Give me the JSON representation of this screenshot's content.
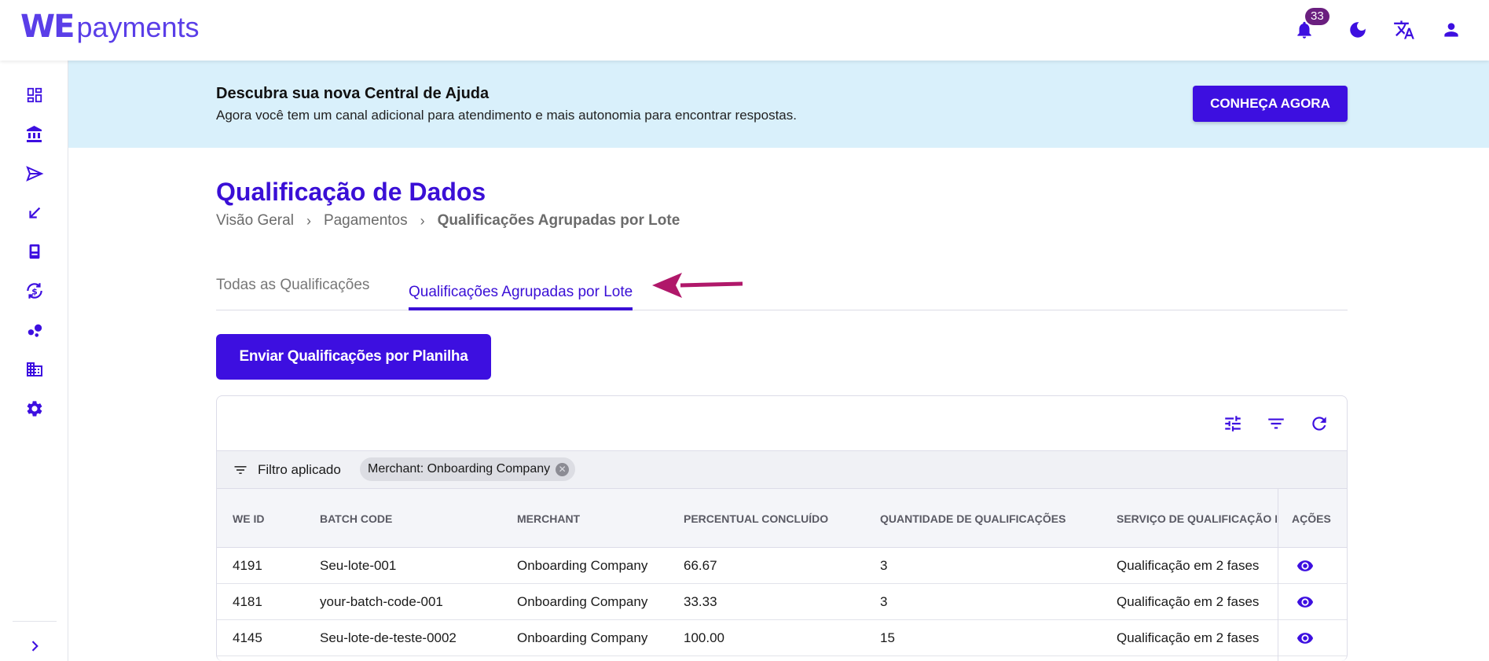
{
  "header": {
    "logo_we": "WE",
    "logo_payments": "payments",
    "notifications_count": "33",
    "icons": [
      "bell-icon",
      "moon-icon",
      "translate-icon",
      "user-icon"
    ]
  },
  "sidebar": {
    "items": [
      {
        "icon": "dashboard-icon"
      },
      {
        "icon": "bank-icon"
      },
      {
        "icon": "send-icon"
      },
      {
        "icon": "receive-arrow-icon"
      },
      {
        "icon": "pos-terminal-icon"
      },
      {
        "icon": "currency-exchange-icon"
      },
      {
        "icon": "bubbles-icon"
      },
      {
        "icon": "building-icon"
      },
      {
        "icon": "settings-icon"
      }
    ],
    "expand_icon": "chevron-right-icon"
  },
  "banner": {
    "title": "Descubra sua nova Central de Ajuda",
    "text": "Agora você tem um canal adicional para atendimento e mais autonomia para encontrar respostas.",
    "button_label": "CONHEÇA AGORA"
  },
  "page": {
    "title": "Qualificação de Dados",
    "breadcrumb": [
      "Visão Geral",
      "Pagamentos",
      "Qualificações Agrupadas por Lote"
    ]
  },
  "tabs": [
    {
      "label": "Todas as Qualificações",
      "active": false
    },
    {
      "label": "Qualificações Agrupadas por Lote",
      "active": true
    }
  ],
  "send_button_label": "Enviar Qualificações por Planilha",
  "table": {
    "toolbar_icons": [
      "columns-settings-icon",
      "filter-icon",
      "refresh-icon"
    ],
    "filter_label": "Filtro aplicado",
    "filter_chip": "Merchant: Onboarding Company",
    "columns": [
      "WE ID",
      "BATCH CODE",
      "MERCHANT",
      "PERCENTUAL CONCLUÍDO",
      "QUANTIDADE DE QUALIFICAÇÕES",
      "SERVIÇO DE QUALIFICAÇÃO DE DADOS",
      "AÇÕES"
    ],
    "rows": [
      {
        "we_id": "4191",
        "batch_code": "Seu-lote-001",
        "merchant": "Onboarding Company",
        "percent": "66.67",
        "quantity": "3",
        "service": "Qualificação em 2 fases"
      },
      {
        "we_id": "4181",
        "batch_code": "your-batch-code-001",
        "merchant": "Onboarding Company",
        "percent": "33.33",
        "quantity": "3",
        "service": "Qualificação em 2 fases"
      },
      {
        "we_id": "4145",
        "batch_code": "Seu-lote-de-teste-0002",
        "merchant": "Onboarding Company",
        "percent": "100.00",
        "quantity": "15",
        "service": "Qualificação em 2 fases"
      }
    ]
  },
  "colors": {
    "primary": "#3d0fe0",
    "title": "#3a0fd6",
    "banner_bg": "#d9f0fb",
    "annotation_arrow": "#b0186a",
    "badge": "#6a1f7f"
  }
}
